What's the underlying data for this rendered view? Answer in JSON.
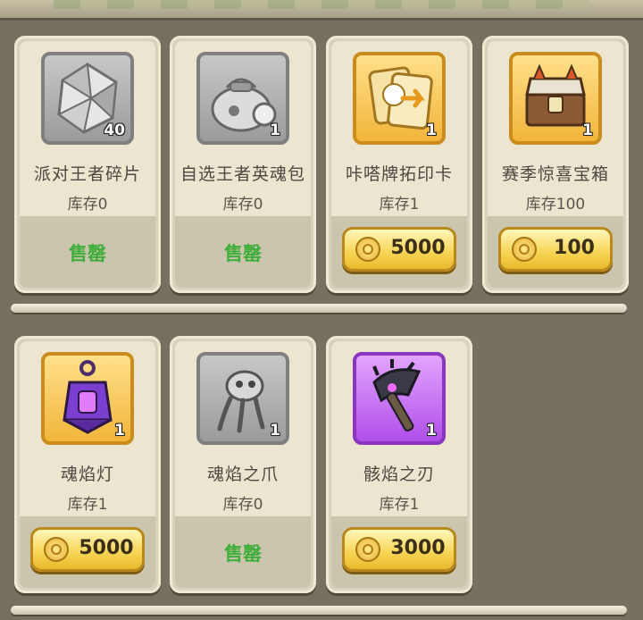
{
  "rows": [
    {
      "items": [
        {
          "name": "派对王者碎片",
          "stock": "库存0",
          "qty": "40",
          "rarity": "gray",
          "icon": "crystal-shard-icon",
          "status": "sold",
          "sold_label": "售罄"
        },
        {
          "name": "自选王者英魂包",
          "stock": "库存0",
          "qty": "1",
          "rarity": "gray",
          "icon": "soul-bag-icon",
          "status": "sold",
          "sold_label": "售罄"
        },
        {
          "name": "咔嗒牌拓印卡",
          "stock": "库存1",
          "qty": "1",
          "rarity": "gold",
          "icon": "card-print-icon",
          "status": "buy",
          "price": "5000"
        },
        {
          "name": "赛季惊喜宝箱",
          "stock": "库存100",
          "qty": "1",
          "rarity": "gold",
          "icon": "treasure-chest-icon",
          "status": "buy",
          "price": "100"
        }
      ]
    },
    {
      "items": [
        {
          "name": "魂焰灯",
          "stock": "库存1",
          "qty": "1",
          "rarity": "gold",
          "icon": "soul-lantern-icon",
          "status": "buy",
          "price": "5000"
        },
        {
          "name": "魂焰之爪",
          "stock": "库存0",
          "qty": "1",
          "rarity": "gray",
          "icon": "claw-icon",
          "status": "sold",
          "sold_label": "售罄"
        },
        {
          "name": "骸焰之刃",
          "stock": "库存1",
          "qty": "1",
          "rarity": "purple",
          "icon": "axe-blade-icon",
          "status": "buy",
          "price": "3000"
        }
      ]
    }
  ],
  "colors": {
    "sold": "#3fae3b",
    "gold_border": "#c98c1d",
    "purple": "#b04fe8",
    "gray": "#9b9b9b"
  }
}
